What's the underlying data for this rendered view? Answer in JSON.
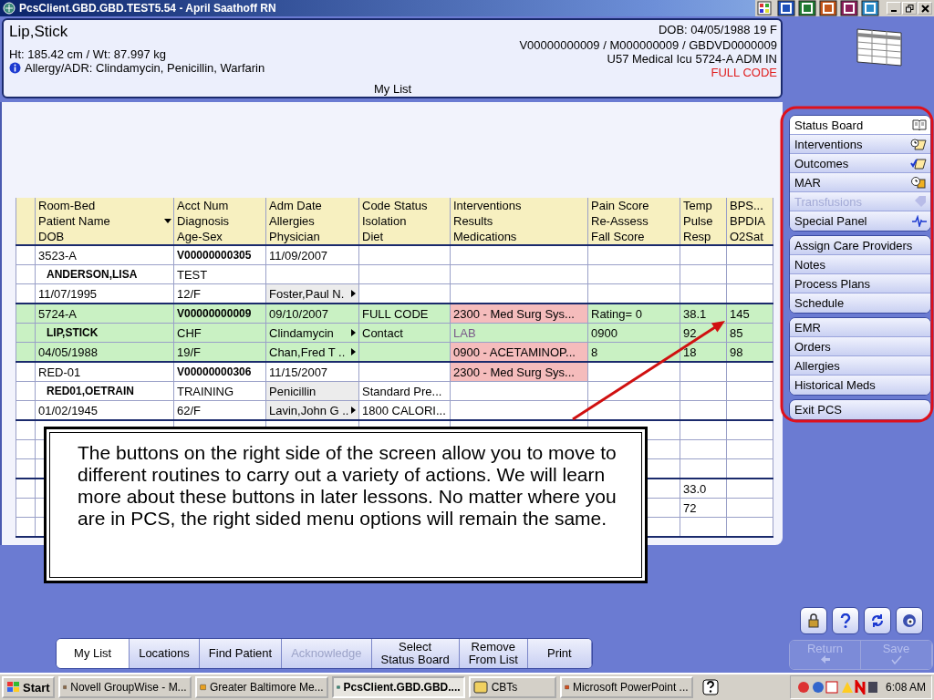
{
  "window": {
    "title": "PcsClient.GBD.GBD.TEST5.54 - April Saathoff RN"
  },
  "patient_header": {
    "name": "Lip,Stick",
    "height_weight": "Ht: 185.42 cm / Wt: 87.997 kg",
    "allergy": "Allergy/ADR: Clindamycin, Penicillin, Warfarin",
    "dob": "DOB: 04/05/1988 19 F",
    "ids": "V00000000009 / M000000009 / GBDVD0000009",
    "location": "U57 Medical Icu  5724-A  ADM IN",
    "code_status": "FULL CODE",
    "list_title": "My List"
  },
  "table": {
    "header_rows": [
      [
        "Room-Bed",
        "Acct Num",
        "Adm Date",
        "Code Status",
        "Interventions",
        "Pain Score",
        "Temp",
        "BPS..."
      ],
      [
        "Patient Name",
        "Diagnosis",
        "Allergies",
        "Isolation",
        "Results",
        "Re-Assess",
        "Pulse",
        "BPDIA"
      ],
      [
        "DOB",
        "Age-Sex",
        "Physician",
        "Diet",
        "Medications",
        "Fall Score",
        "Resp",
        "O2Sat"
      ]
    ],
    "patients": [
      {
        "selected": false,
        "rows": [
          [
            "3523-A",
            "V00000000305",
            "11/09/2007",
            "",
            "",
            "",
            "",
            ""
          ],
          [
            "ANDERSON,LISA",
            "TEST",
            "",
            "",
            "",
            "",
            "",
            ""
          ],
          [
            "11/07/1995",
            "12/F",
            {
              "text": "Foster,Paul N.",
              "kind": "more"
            },
            "",
            "",
            "",
            "",
            ""
          ]
        ]
      },
      {
        "selected": true,
        "rows": [
          [
            "5724-A",
            "V00000000009",
            "09/10/2007",
            "FULL CODE",
            {
              "text": "2300 - Med Surg Sys...",
              "kind": "alert"
            },
            "Rating= 0",
            "38.1",
            "145"
          ],
          [
            "LIP,STICK",
            "CHF",
            {
              "text": "Clindamycin",
              "kind": "more"
            },
            "Contact",
            {
              "text": "LAB",
              "kind": "muted"
            },
            "0900",
            "92",
            "85"
          ],
          [
            "04/05/1988",
            "19/F",
            {
              "text": "Chan,Fred T ..",
              "kind": "more"
            },
            "",
            {
              "text": "0900 - ACETAMINOP...",
              "kind": "alert"
            },
            "8",
            "18",
            "98"
          ]
        ]
      },
      {
        "selected": false,
        "rows": [
          [
            "RED-01",
            "V00000000306",
            "11/15/2007",
            "",
            {
              "text": "2300 - Med Surg Sys...",
              "kind": "alert"
            },
            "",
            "",
            ""
          ],
          [
            "RED01,OETRAIN",
            "TRAINING",
            {
              "text": "Penicillin",
              "kind": "shaded"
            },
            "Standard Pre...",
            "",
            "",
            "",
            ""
          ],
          [
            "01/02/1945",
            "62/F",
            {
              "text": "Lavin,John G ..",
              "kind": "more"
            },
            "1800 CALORI...",
            "",
            "",
            "",
            ""
          ]
        ]
      },
      {
        "selected": false,
        "rows": [
          [
            "",
            "",
            "",
            "",
            "",
            "",
            "",
            ""
          ],
          [
            "",
            "",
            "",
            "",
            "",
            "",
            "",
            ""
          ],
          [
            "",
            "",
            "",
            "",
            "",
            "",
            "",
            ""
          ]
        ]
      },
      {
        "selected": false,
        "rows": [
          [
            "",
            "",
            "",
            "",
            "",
            "",
            "33.0",
            ""
          ],
          [
            "",
            "",
            "",
            "",
            "",
            "",
            "72",
            ""
          ],
          [
            "",
            "",
            "",
            "",
            "",
            "",
            "",
            ""
          ]
        ]
      }
    ]
  },
  "callout": "The buttons on the right side of the screen allow you to move to different routines to carry out a variety of actions. We will learn more about these buttons in later lessons. No matter where you are in PCS, the right sided menu options will remain the same.",
  "side_menu": [
    {
      "items": [
        {
          "label": "Status Board",
          "kind": "book",
          "selected": true,
          "disabled": false
        },
        {
          "label": "Interventions",
          "kind": "clock-note",
          "selected": false,
          "disabled": false
        },
        {
          "label": "Outcomes",
          "kind": "check-note",
          "selected": false,
          "disabled": false
        },
        {
          "label": "MAR",
          "kind": "clock-box",
          "selected": false,
          "disabled": false
        },
        {
          "label": "Transfusions",
          "kind": "tag",
          "selected": false,
          "disabled": true
        },
        {
          "label": "Special Panel",
          "kind": "pulse",
          "selected": false,
          "disabled": false
        }
      ]
    },
    {
      "items": [
        {
          "label": "Assign Care Providers",
          "selected": false,
          "disabled": false
        },
        {
          "label": "Notes",
          "selected": false,
          "disabled": false
        },
        {
          "label": "Process Plans",
          "selected": false,
          "disabled": false
        },
        {
          "label": "Schedule",
          "selected": false,
          "disabled": false
        }
      ]
    },
    {
      "items": [
        {
          "label": "EMR",
          "selected": false,
          "disabled": false
        },
        {
          "label": "Orders",
          "selected": false,
          "disabled": false
        },
        {
          "label": "Allergies",
          "selected": false,
          "disabled": false
        },
        {
          "label": "Historical Meds",
          "selected": false,
          "disabled": false
        }
      ]
    },
    {
      "items": [
        {
          "label": "Exit PCS",
          "selected": false,
          "disabled": false
        }
      ]
    }
  ],
  "bottom_tabs": [
    {
      "label": "My List",
      "selected": true,
      "disabled": false
    },
    {
      "label": "Locations",
      "selected": false,
      "disabled": false
    },
    {
      "label": "Find Patient",
      "selected": false,
      "disabled": false
    },
    {
      "label": "Acknowledge",
      "selected": false,
      "disabled": true
    },
    {
      "label": "Select\nStatus Board",
      "selected": false,
      "disabled": false
    },
    {
      "label": "Remove\nFrom List",
      "selected": false,
      "disabled": false
    },
    {
      "label": "Print",
      "selected": false,
      "disabled": false
    }
  ],
  "action_buttons": [
    {
      "label": "Return",
      "disabled": true
    },
    {
      "label": "Save",
      "disabled": true
    }
  ],
  "taskbar": {
    "start": "Start",
    "tasks": [
      {
        "label": "Novell GroupWise - M...",
        "selected": false
      },
      {
        "label": "Greater Baltimore Me...",
        "selected": false
      },
      {
        "label": "PcsClient.GBD.GBD....",
        "selected": true
      },
      {
        "label": "CBTs",
        "selected": false
      },
      {
        "label": "Microsoft PowerPoint ...",
        "selected": false
      }
    ],
    "clock": "6:08 AM"
  }
}
